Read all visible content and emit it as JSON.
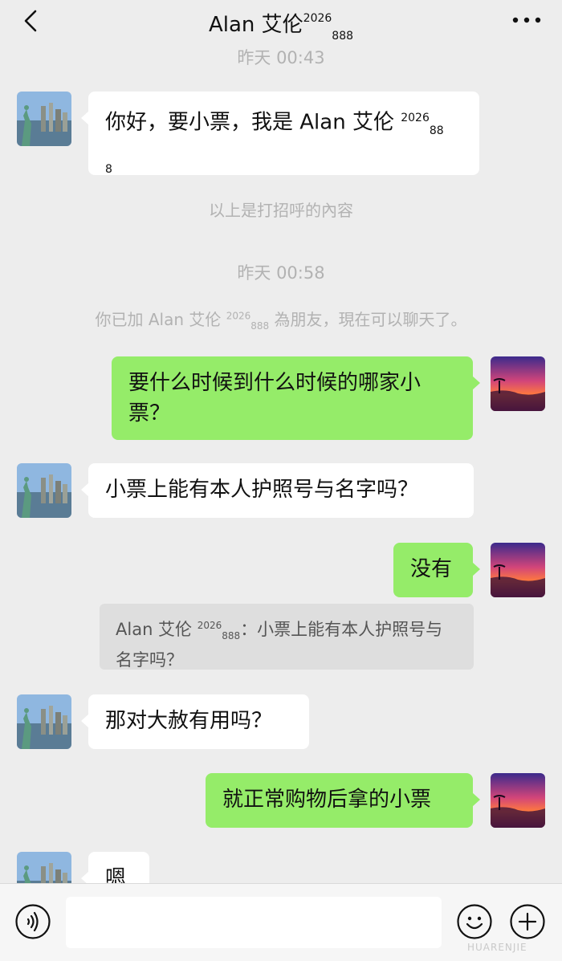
{
  "header": {
    "contact_name": "Alan 艾伦",
    "contact_sup": "2026",
    "contact_sub": "888"
  },
  "messages": {
    "time_1": "昨天 00:43",
    "m1_text": "你好，要小票，我是 Alan 艾伦 ",
    "m1_sup": "2026",
    "m1_sub_a": "88",
    "m1_sub_b": "8",
    "greeting_note": "以上是打招呼的內容",
    "time_2": "昨天 00:58",
    "added_prefix": "你已加 Alan 艾伦 ",
    "added_sup": "2026",
    "added_sub": "888",
    "added_suffix": " 為朋友，現在可以聊天了。",
    "m2_text": "要什么时候到什么时候的哪家小票？",
    "m3_text": "小票上能有本人护照号与名字吗？",
    "m4_text": "没有",
    "quote_name": "Alan 艾伦 ",
    "quote_sup": "2026",
    "quote_sub": "888",
    "quote_text": "：小票上能有本人护照号与名字吗？",
    "m5_text": "那对大赦有用吗？",
    "m6_text": "就正常购物后拿的小票",
    "m7_text": "嗯"
  },
  "footer": {
    "watermark": "HUARENJIE"
  },
  "icons": {
    "back": "chevron-left-icon",
    "more": "more-icon",
    "voice": "voice-icon",
    "emoji": "emoji-icon",
    "plus": "plus-icon"
  },
  "colors": {
    "background": "#ededed",
    "outgoing_bubble": "#95ec69",
    "incoming_bubble": "#ffffff",
    "timestamp": "#b2b2b2"
  }
}
